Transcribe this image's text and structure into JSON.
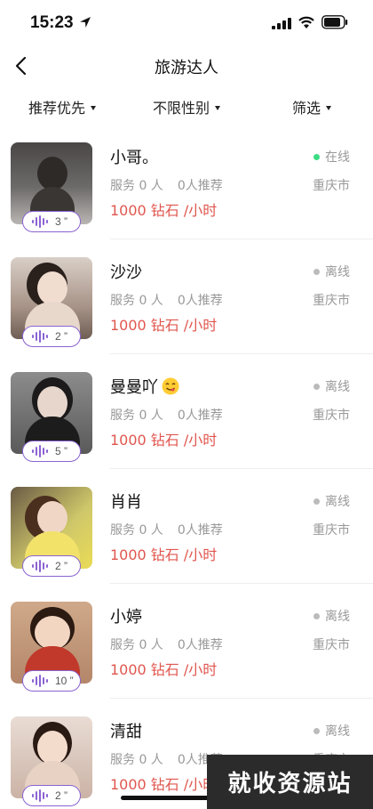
{
  "status_bar": {
    "time": "15:23"
  },
  "nav": {
    "title": "旅游达人"
  },
  "filters": [
    {
      "label": "推荐优先"
    },
    {
      "label": "不限性别"
    },
    {
      "label": "筛选"
    }
  ],
  "colors": {
    "online": "#3ddc84",
    "offline": "#bbbbbb",
    "price": "#e0564e",
    "voice_border": "#8a63d2"
  },
  "users": [
    {
      "name": "小哥。",
      "emoji": "",
      "services": "服务 0 人",
      "recommends": "0人推荐",
      "price": "1000 钻石 /小时",
      "status": "在线",
      "online": true,
      "city": "重庆市",
      "voice_duration": "3 ”"
    },
    {
      "name": "沙沙",
      "emoji": "",
      "services": "服务 0 人",
      "recommends": "0人推荐",
      "price": "1000 钻石 /小时",
      "status": "离线",
      "online": false,
      "city": "重庆市",
      "voice_duration": "2 ”"
    },
    {
      "name": "曼曼吖",
      "emoji": "😋",
      "services": "服务 0 人",
      "recommends": "0人推荐",
      "price": "1000 钻石 /小时",
      "status": "离线",
      "online": false,
      "city": "重庆市",
      "voice_duration": "5 ”"
    },
    {
      "name": "肖肖",
      "emoji": "",
      "services": "服务 0 人",
      "recommends": "0人推荐",
      "price": "1000 钻石 /小时",
      "status": "离线",
      "online": false,
      "city": "重庆市",
      "voice_duration": "2 ”"
    },
    {
      "name": "小婷",
      "emoji": "",
      "services": "服务 0 人",
      "recommends": "0人推荐",
      "price": "1000 钻石 /小时",
      "status": "离线",
      "online": false,
      "city": "重庆市",
      "voice_duration": "10 ”"
    },
    {
      "name": "清甜",
      "emoji": "",
      "services": "服务 0 人",
      "recommends": "0人推荐",
      "price": "1000 钻石 /小时",
      "status": "离线",
      "online": false,
      "city": "重庆市",
      "voice_duration": "2 ”"
    }
  ],
  "watermark": "就收资源站"
}
